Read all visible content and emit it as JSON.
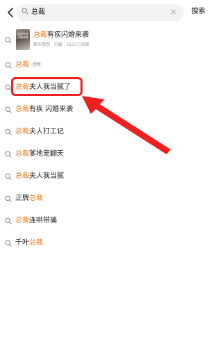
{
  "header": {
    "query": "总裁",
    "search_label": "搜索",
    "back_icon": "chevron-left-icon",
    "search_icon": "search-icon",
    "clear_icon": "close-icon"
  },
  "book": {
    "title_highlight": "总裁",
    "title_rest": "有疾闪婚来袭",
    "meta": "都市情感 · 闪婚 · 3131万热度",
    "cover_text": "总裁有疾闪婚来袭"
  },
  "suggestions": [
    {
      "hl": "总裁",
      "rest": "",
      "badge": "分类"
    },
    {
      "hl": "总裁",
      "rest": "夫人我当腻了"
    },
    {
      "hl": "总裁",
      "rest": "有疾 闪婚来袭"
    },
    {
      "hl": "总裁",
      "rest": "夫人打工记"
    },
    {
      "hl": "总裁",
      "rest": "爹地宠翻天"
    },
    {
      "hl": "总裁",
      "rest": "夫人我当腻"
    },
    {
      "pre": "正牌",
      "hl": "总裁"
    },
    {
      "hl": "总裁",
      "rest": "连哄带骗"
    },
    {
      "pre": "千叶",
      "hl": "总裁"
    }
  ],
  "colors": {
    "highlight": "#f07d22",
    "annotation": "#ee1f1f"
  }
}
